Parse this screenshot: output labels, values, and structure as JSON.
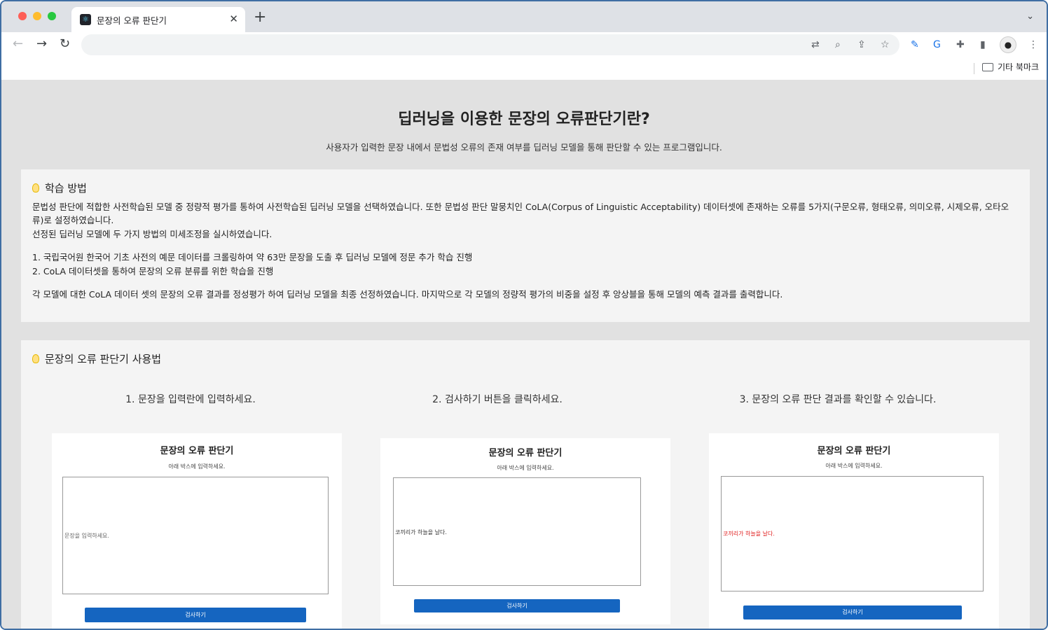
{
  "browser": {
    "tab_title": "문장의 오류 판단기",
    "tab_favicon": "react-icon",
    "close_glyph": "✕",
    "new_tab_glyph": "+",
    "tab_list_glyph": "⌄",
    "bookmark_folder": "기타 북마크"
  },
  "hero": {
    "title": "딥러닝을 이용한 문장의 오류판단기란?",
    "subtitle": "사용자가 입력한 문장 내에서 문법성 오류의 존재 여부를 딥러닝 모델을 통해 판단할 수 있는 프로그램입니다."
  },
  "learn": {
    "heading": "학습 방법",
    "p1": "문법성 판단에 적합한 사전학습된 모델 중 정량적 평가를 통하여 사전학습된 딥러닝 모델을 선택하였습니다. 또한 문법성 판단 말뭉치인 CoLA(Corpus of Linguistic Acceptability) 데이터셋에 존재하는 오류를 5가지(구문오류, 형태오류, 의미오류, 시제오류, 오타오류)로 설정하였습니다.",
    "p2": "선정된 딥러닝 모델에 두 가지 방법의 미세조정을 실시하였습니다.",
    "item1": "1. 국립국어원 한국어 기초 사전의 예문 데이터를 크롤링하여 약 63만 문장을 도출 후 딥러닝 모델에 정문 추가 학습 진행",
    "item2": "2. CoLA 데이터셋을 통하여 문장의 오류 분류를 위한 학습을 진행",
    "p3": "각 모델에 대한 CoLA 데이터 셋의 문장의 오류 결과를 정성평가 하여 딥러닝 모델을 최종 선정하였습니다. 마지막으로 각 모델의 정량적 평가의 비중을 설정 후 앙상블을 통해 모델의 예측 결과를 출력합니다."
  },
  "usage": {
    "heading": "문장의 오류 판단기 사용법",
    "steps": [
      "1. 문장을 입력란에 입력하세요.",
      "2. 검사하기 버튼을 클릭하세요.",
      "3. 문장의 오류 판단 결과를 확인할 수 있습니다."
    ],
    "shots": [
      {
        "title": "문장의 오류 판단기",
        "hint": "아래 박스에 입력하세요.",
        "text": "문장을 입력하세요.",
        "button": "검사하기"
      },
      {
        "title": "문장의 오류 판단기",
        "hint": "아래 박스에 입력하세요.",
        "text": "코끼리가 하늘을 날다.",
        "button": "검사하기"
      },
      {
        "title": "문장의 오류 판단기",
        "hint": "아래 박스에 입력하세요.",
        "text": "코끼리가 하늘을 날다.",
        "button": "검사하기"
      }
    ]
  },
  "colors": {
    "page_bg": "#e1e1e1",
    "card_bg": "#f4f4f4",
    "button_blue": "#1565c0",
    "error_red": "#e02020"
  }
}
